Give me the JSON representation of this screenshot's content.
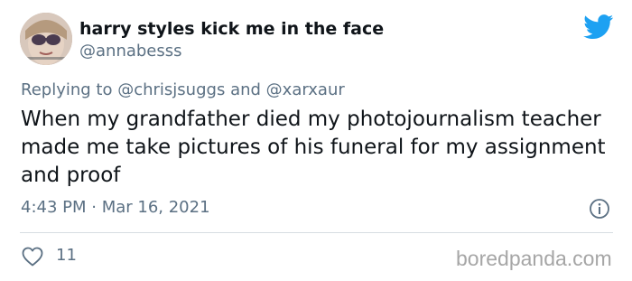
{
  "user": {
    "display_name": "harry styles kick me in the face",
    "handle": "@annabesss"
  },
  "reply": {
    "prefix": "Replying to",
    "mention_1": "@chrisjsuggs",
    "conjunction": "and",
    "mention_2": "@xarxaur"
  },
  "tweet": {
    "text": "When my grandfather died my photojournalism teacher made me take pictures of his funeral for my assignment and proof",
    "timestamp": "4:43 PM · Mar 16, 2021"
  },
  "actions": {
    "like_count": "11"
  },
  "icons": {
    "brand": "twitter-bird-icon",
    "info": "info-icon",
    "like": "heart-icon"
  },
  "watermark": "boredpanda.com",
  "colors": {
    "twitter_blue": "#1da1f2",
    "secondary_text": "#5b7083",
    "primary_text": "#0f1419",
    "divider": "#d7dde2"
  }
}
